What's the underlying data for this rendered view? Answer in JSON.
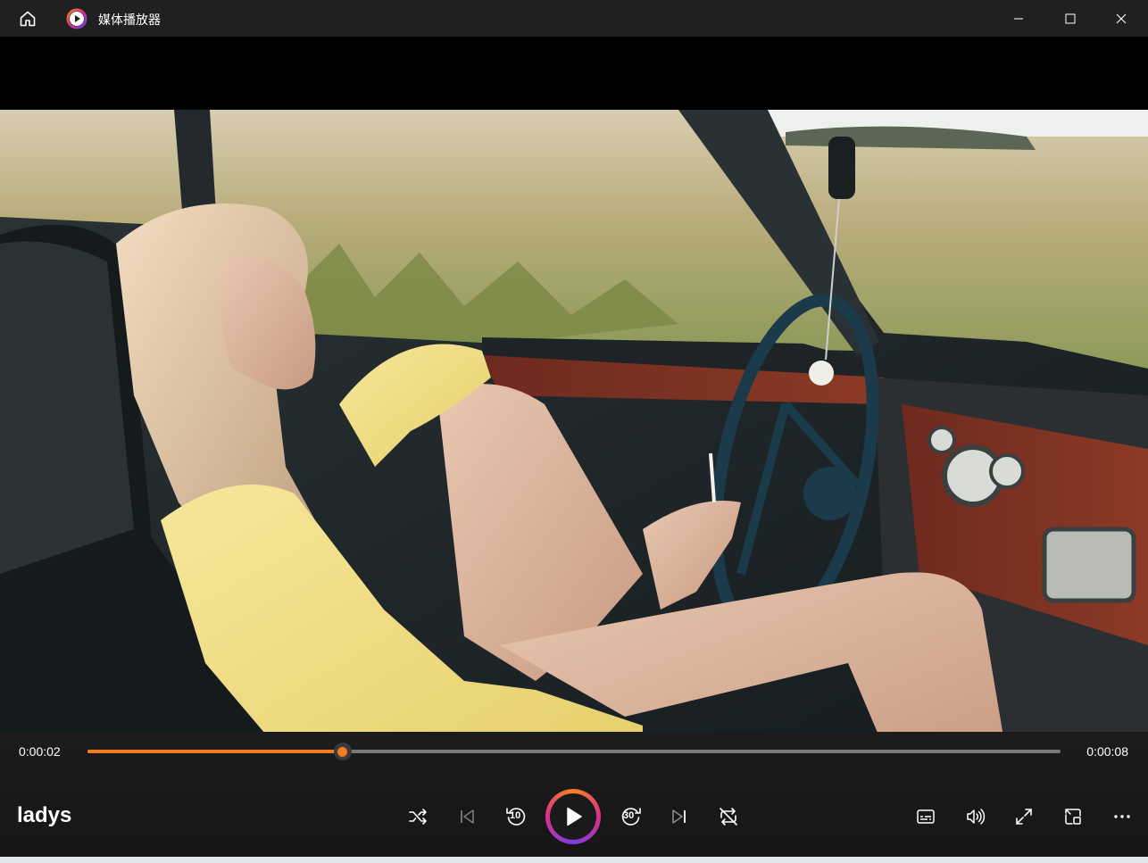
{
  "window": {
    "app_title": "媒体播放器"
  },
  "player": {
    "current_time": "0:00:02",
    "total_time": "0:00:08",
    "progress_fraction": 0.262,
    "media_title": "ladys"
  },
  "colors": {
    "accent": "#f57c1f",
    "titlebar_bg": "#202020",
    "controls_bg": "#1c1c1c"
  },
  "controls": {
    "left_group": [
      "shuffle-icon",
      "previous-icon",
      "skip-back-10-icon",
      "play-icon",
      "skip-forward-30-icon",
      "next-icon",
      "repeat-off-icon"
    ],
    "right_group": [
      "subtitles-icon",
      "volume-icon",
      "fullscreen-icon",
      "mini-player-icon",
      "more-icon"
    ],
    "skip_back_label": "10",
    "skip_forward_label": "30"
  }
}
